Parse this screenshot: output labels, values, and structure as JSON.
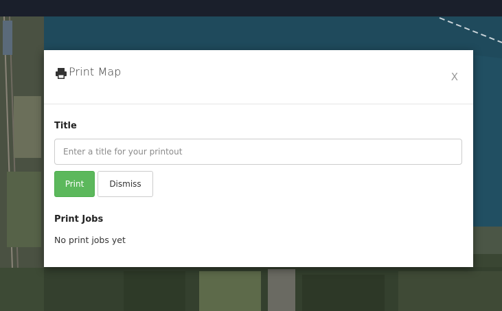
{
  "dialog": {
    "title": "Print Map",
    "close_label": "X",
    "title_label": "Title",
    "title_input_placeholder": "Enter a title for your printout",
    "title_input_value": "",
    "print_button": "Print",
    "dismiss_button": "Dismiss",
    "jobs_heading": "Print Jobs",
    "jobs_status": "No print jobs yet"
  },
  "icons": {
    "header": "printer-icon"
  },
  "colors": {
    "primary_button": "#5cb85c",
    "water": "#1f4a5c",
    "top_bar": "#1a1f2b"
  }
}
